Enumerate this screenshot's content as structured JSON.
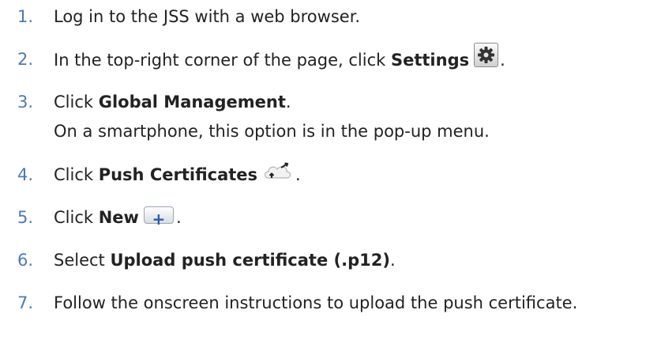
{
  "steps": [
    {
      "number": "1.",
      "text": "Log in to the JSS with a web browser."
    },
    {
      "number": "2.",
      "prefix": "In the top-right corner of the page, click ",
      "bold": "Settings",
      "icon": "gear-icon",
      "suffix": "."
    },
    {
      "number": "3.",
      "prefix": "Click ",
      "bold": "Global Management",
      "suffix": ".",
      "note": "On a smartphone, this option is in the pop-up menu."
    },
    {
      "number": "4.",
      "prefix": "Click ",
      "bold": "Push Certificates",
      "icon": "cloud-upload-icon",
      "suffix": "."
    },
    {
      "number": "5.",
      "prefix": "Click ",
      "bold": "New",
      "icon": "plus-icon",
      "button_symbol": "+",
      "suffix": "."
    },
    {
      "number": "6.",
      "prefix": "Select ",
      "bold": "Upload push certificate (.p12)",
      "suffix": "."
    },
    {
      "number": "7.",
      "text": "Follow the onscreen instructions to upload the push certificate."
    }
  ],
  "colors": {
    "number": "#4a7ab8",
    "text": "#222222",
    "plus": "#2a5db0"
  }
}
